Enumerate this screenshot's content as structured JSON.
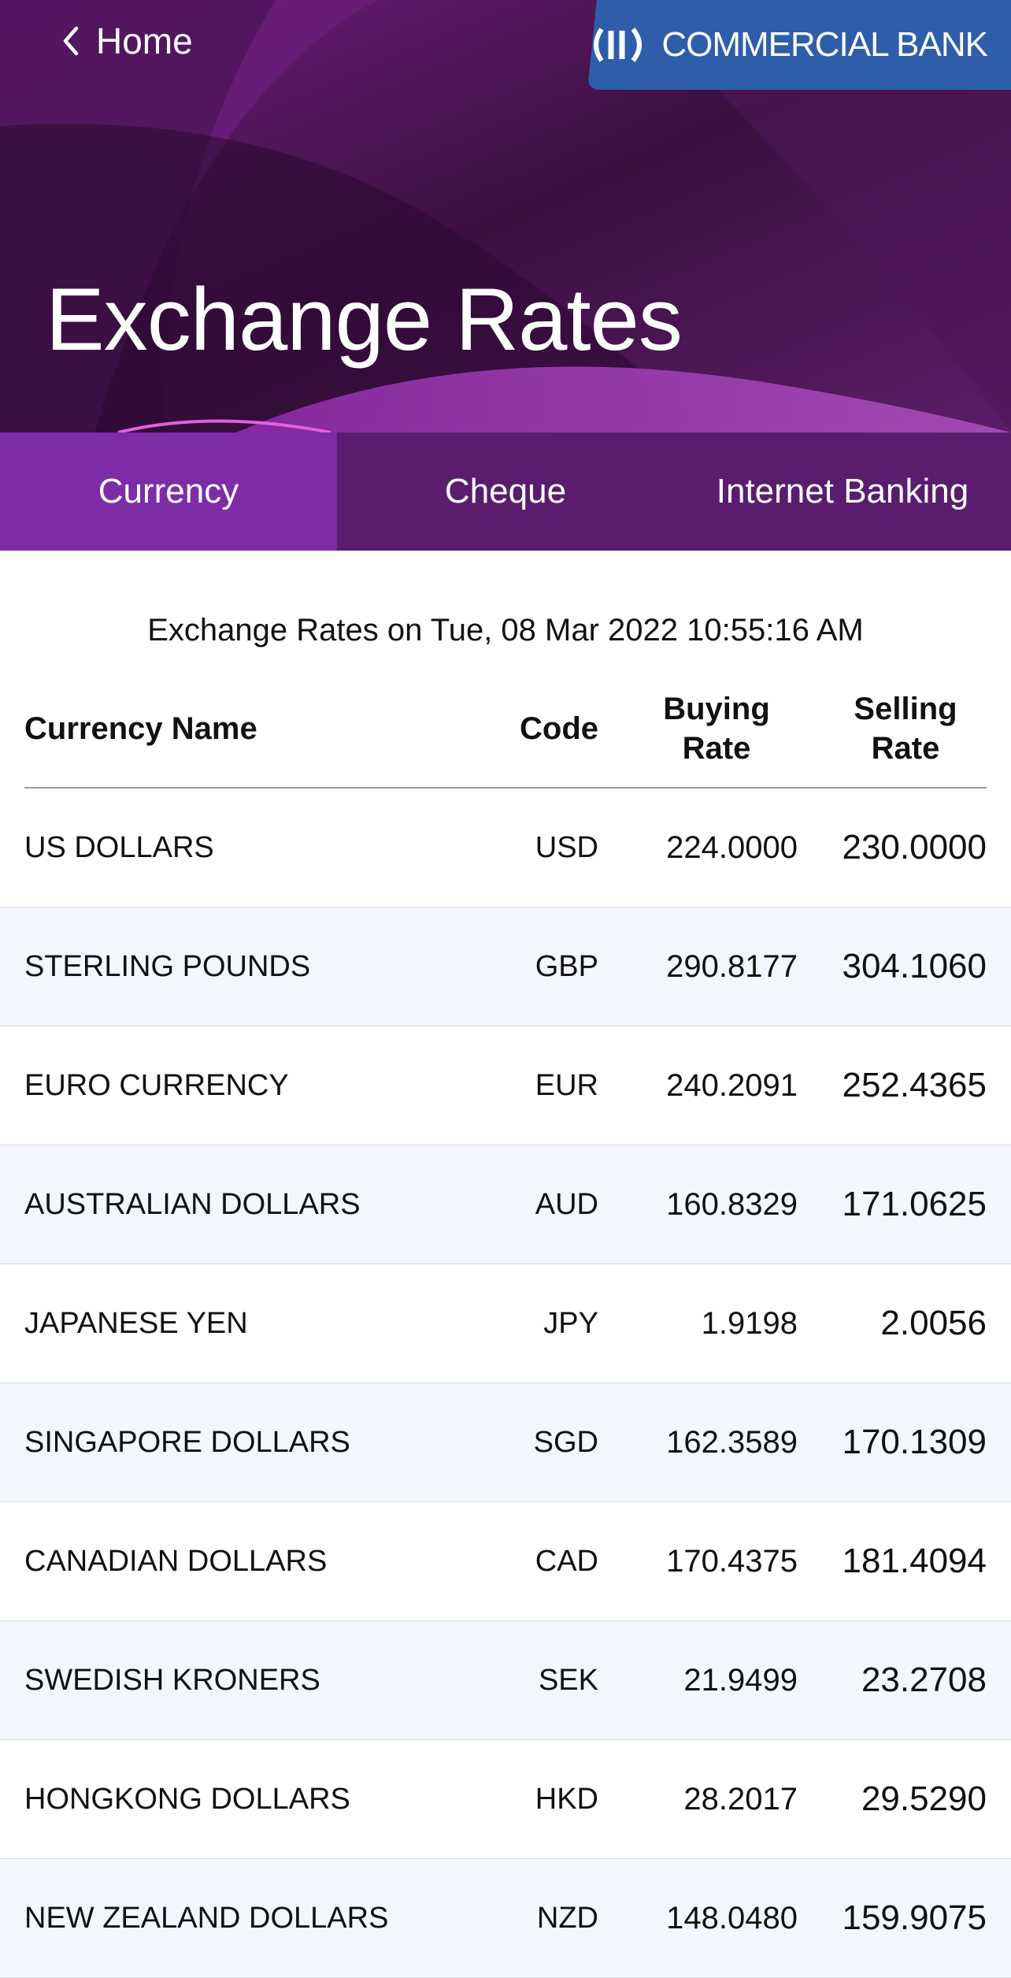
{
  "nav": {
    "back_label": "Home"
  },
  "brand": {
    "name": "COMMERCIAL BANK"
  },
  "page_title": "Exchange Rates",
  "tabs": [
    {
      "label": "Currency",
      "active": true
    },
    {
      "label": "Cheque",
      "active": false
    },
    {
      "label": "Internet Banking",
      "active": false
    }
  ],
  "timestamp": "Exchange Rates on Tue, 08 Mar 2022 10:55:16 AM",
  "table": {
    "headers": {
      "name": "Currency Name",
      "code": "Code",
      "buying": "Buying Rate",
      "selling": "Selling Rate"
    },
    "rows": [
      {
        "name": "US DOLLARS",
        "code": "USD",
        "buying": "224.0000",
        "selling": "230.0000"
      },
      {
        "name": "STERLING POUNDS",
        "code": "GBP",
        "buying": "290.8177",
        "selling": "304.1060"
      },
      {
        "name": "EURO CURRENCY",
        "code": "EUR",
        "buying": "240.2091",
        "selling": "252.4365"
      },
      {
        "name": "AUSTRALIAN DOLLARS",
        "code": "AUD",
        "buying": "160.8329",
        "selling": "171.0625"
      },
      {
        "name": "JAPANESE YEN",
        "code": "JPY",
        "buying": "1.9198",
        "selling": "2.0056"
      },
      {
        "name": "SINGAPORE DOLLARS",
        "code": "SGD",
        "buying": "162.3589",
        "selling": "170.1309"
      },
      {
        "name": "CANADIAN DOLLARS",
        "code": "CAD",
        "buying": "170.4375",
        "selling": "181.4094"
      },
      {
        "name": "SWEDISH KRONERS",
        "code": "SEK",
        "buying": "21.9499",
        "selling": "23.2708"
      },
      {
        "name": "HONGKONG DOLLARS",
        "code": "HKD",
        "buying": "28.2017",
        "selling": "29.5290"
      },
      {
        "name": "NEW ZEALAND DOLLARS",
        "code": "NZD",
        "buying": "148.0480",
        "selling": "159.9075"
      }
    ]
  },
  "colors": {
    "header_bg": "#3a1140",
    "tab_active": "#7e2ca6",
    "tab_inactive": "#5a1d6e",
    "brand_blue": "#2e5eaa",
    "row_alt": "#f3f6fc"
  },
  "icons": {
    "back": "chevron-left-icon",
    "brand": "bank-logo-icon"
  }
}
